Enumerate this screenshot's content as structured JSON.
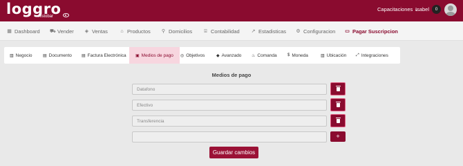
{
  "brand": {
    "name": "loggro",
    "sublabel": "restobar"
  },
  "header": {
    "org_menu": "Capacitaciones ⌄",
    "user_name": "Isabel",
    "notification_count": "0"
  },
  "nav": {
    "items": [
      {
        "label": "Dashboard",
        "icon": "dashboard-icon"
      },
      {
        "label": "Vender",
        "icon": "cart-icon"
      },
      {
        "label": "Ventas",
        "icon": "tag-icon"
      },
      {
        "label": "Productos",
        "icon": "basket-icon"
      },
      {
        "label": "Domicilios",
        "icon": "bike-icon"
      },
      {
        "label": "Contabilidad",
        "icon": "bank-icon"
      },
      {
        "label": "Estadisticas",
        "icon": "chart-icon"
      },
      {
        "label": "Configuracion",
        "icon": "gear-icon"
      },
      {
        "label": "Pagar Suscripcion",
        "icon": "card-icon"
      }
    ]
  },
  "tabs": [
    {
      "label": "Negocio",
      "icon": "building-icon"
    },
    {
      "label": "Documento",
      "icon": "document-icon"
    },
    {
      "label": "Factura Electrónica",
      "icon": "invoice-icon"
    },
    {
      "label": "Medios de pago",
      "icon": "payment-icon"
    },
    {
      "label": "Objetivos",
      "icon": "target-icon"
    },
    {
      "label": "Avanzado",
      "icon": "bolt-icon"
    },
    {
      "label": "Comanda",
      "icon": "chef-icon"
    },
    {
      "label": "Moneda",
      "icon": "dollar-icon"
    },
    {
      "label": "Ubicación",
      "icon": "map-icon"
    },
    {
      "label": "Integraciones",
      "icon": "plug-icon"
    }
  ],
  "payment_methods": {
    "title": "Medios de pago",
    "items": [
      "Datafono",
      "Efectivo",
      "Transferencia"
    ],
    "new_item_value": "",
    "add_label": "+",
    "save_label": "Guardar cambios"
  },
  "colors": {
    "brand": "#8a0b2f",
    "active_tab_bg": "#f7d6df",
    "page_bg": "#e9e9e9"
  }
}
